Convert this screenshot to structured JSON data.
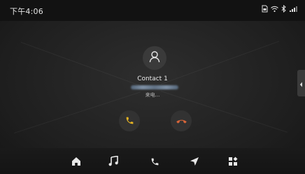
{
  "status_bar": {
    "time": "下午4:06",
    "icons": [
      "sim-card-icon",
      "wifi-icon",
      "bluetooth-icon",
      "signal-icon"
    ]
  },
  "call": {
    "contact_name": "Contact 1",
    "status_text": "来电...",
    "answer_icon": "phone-answer-icon",
    "decline_icon": "phone-hangup-icon",
    "answer_color": "#e6b422",
    "decline_color": "#d9663a"
  },
  "side_tab": {
    "icon": "chevron-left-icon"
  },
  "bottom_nav": {
    "items": [
      {
        "id": "home",
        "icon": "home-icon"
      },
      {
        "id": "music",
        "icon": "music-note-icon"
      },
      {
        "id": "phone",
        "icon": "phone-icon"
      },
      {
        "id": "navigation",
        "icon": "navigation-arrow-icon"
      },
      {
        "id": "apps",
        "icon": "apps-grid-icon"
      }
    ]
  }
}
